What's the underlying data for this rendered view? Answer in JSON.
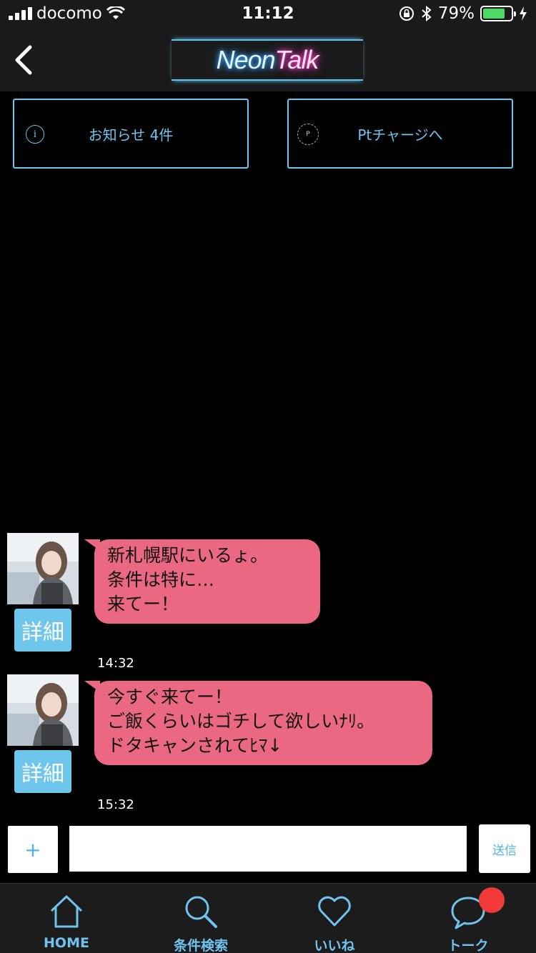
{
  "status_bar": {
    "carrier": "docomo",
    "time": "11:12",
    "battery": "79%",
    "battery_level": 0.79
  },
  "header": {
    "logo_part1": "Neon",
    "logo_part2": "Talk"
  },
  "notice": {
    "label": "お知らせ 4件",
    "icon": "i"
  },
  "charge": {
    "label": "Ptチャージへ",
    "icon": "P"
  },
  "messages": [
    {
      "lines": [
        "新札幌駅にいるょ。",
        "条件は特に…",
        "来てー！"
      ],
      "detail_label": "詳細",
      "time": "14:32"
    },
    {
      "lines": [
        "今すぐ来てー！",
        "ご飯くらいはゴチして欲しいﾅﾘ。",
        "ドタキャンされてﾋﾏ↓"
      ],
      "detail_label": "詳細",
      "time": "15:32"
    }
  ],
  "input": {
    "plus_label": "+",
    "value": "",
    "send_label": "送信"
  },
  "tabs": [
    {
      "label": "HOME",
      "icon": "home-icon"
    },
    {
      "label": "条件検索",
      "icon": "search-icon"
    },
    {
      "label": "いいね",
      "icon": "heart-icon"
    },
    {
      "label": "トーク",
      "icon": "chat-icon"
    }
  ],
  "colors": {
    "accent": "#6ec3ef",
    "bubble": "#eb6883",
    "badge": "#f23a3a"
  }
}
